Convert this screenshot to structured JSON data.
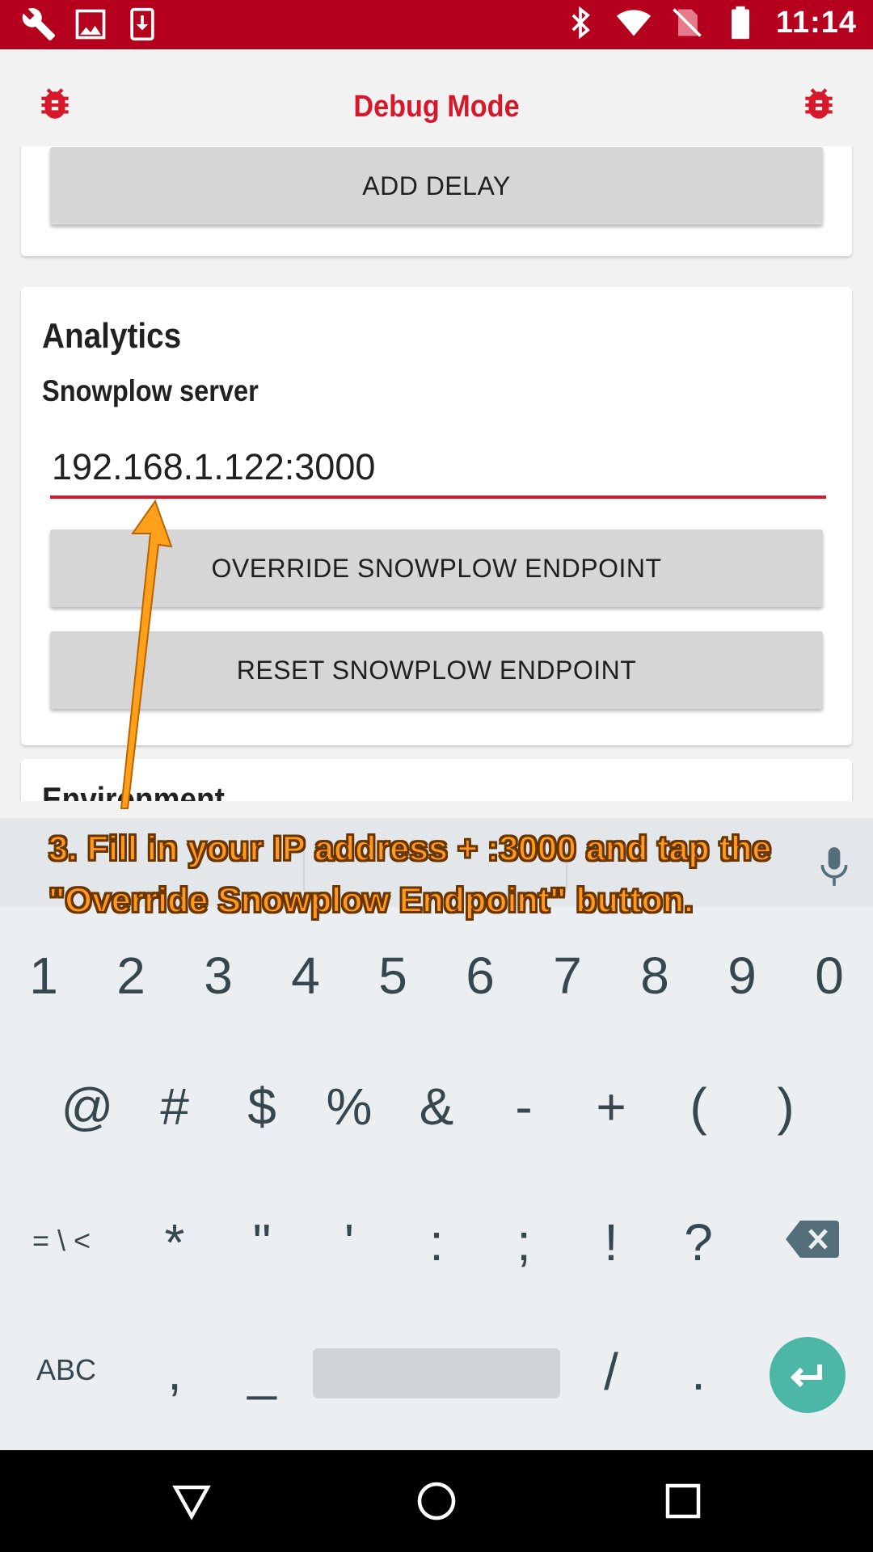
{
  "status_bar": {
    "time": "11:14",
    "left_icons": [
      "wrench-icon",
      "image-icon",
      "download-icon"
    ],
    "right_icons": [
      "bluetooth-icon",
      "wifi-icon",
      "no-sim-icon",
      "battery-icon"
    ]
  },
  "header": {
    "title": "Debug Mode",
    "left_icon": "bug-icon",
    "right_icon": "bug-icon"
  },
  "sections": {
    "top": {
      "button_label": "ADD DELAY"
    },
    "analytics": {
      "title": "Analytics",
      "subtitle": "Snowplow server",
      "input_value": "192.168.1.122:3000",
      "override_button": "OVERRIDE SNOWPLOW ENDPOINT",
      "reset_button": "RESET SNOWPLOW ENDPOINT"
    },
    "environment": {
      "title": "Environment"
    }
  },
  "annotation": {
    "text": "3. Fill in your IP address + :3000 and tap the \"Override Snowplow Endpoint\" button."
  },
  "keyboard": {
    "row1": [
      "1",
      "2",
      "3",
      "4",
      "5",
      "6",
      "7",
      "8",
      "9",
      "0"
    ],
    "row2": [
      "@",
      "#",
      "$",
      "%",
      "&",
      "-",
      "+",
      "(",
      ")"
    ],
    "row3": [
      "= \\ <",
      "*",
      "\"",
      "'",
      ":",
      ";",
      "!",
      "?"
    ],
    "row4": [
      "ABC",
      ",",
      "_",
      "/",
      "."
    ],
    "icons": [
      "mic-icon",
      "backspace-icon",
      "enter-icon"
    ]
  },
  "nav_bar": {
    "icons": [
      "back-icon",
      "home-icon",
      "recents-icon"
    ]
  },
  "colors": {
    "status_bar": "#b5001e",
    "accent": "#d5192b",
    "annotation": "#ff9a1f",
    "enter_key": "#4cb7a6"
  }
}
